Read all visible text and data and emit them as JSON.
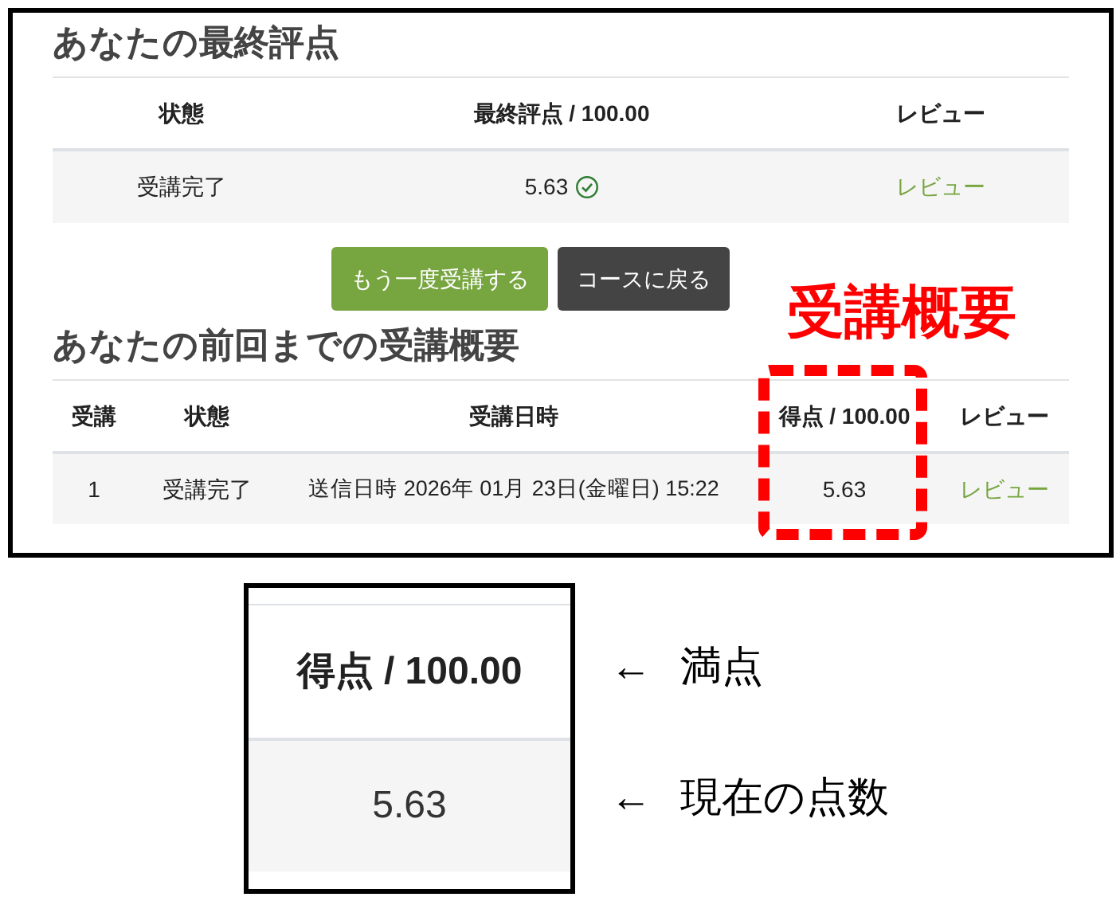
{
  "final_grade": {
    "title": "あなたの最終評点",
    "columns": [
      "状態",
      "最終評点 / 100.00",
      "レビュー"
    ],
    "row": {
      "status": "受講完了",
      "grade": "5.63",
      "passed": true,
      "review": "レビュー"
    }
  },
  "buttons": [
    {
      "label": "もう一度受講する",
      "kind": "primary"
    },
    {
      "label": "コースに戻る",
      "kind": "secondary"
    }
  ],
  "summary": {
    "title": "あなたの前回までの受講概要",
    "columns": [
      "受講",
      "状態",
      "受講日時",
      "得点 / 100.00",
      "レビュー"
    ],
    "rows": [
      {
        "attempt": "1",
        "status": "受講完了",
        "date": "送信日時 2026年 01月 23日(金曜日) 15:22",
        "grade": "5.63",
        "review": "レビュー"
      }
    ]
  },
  "annotations": {
    "callout_label": "受講概要",
    "zoom": {
      "header": "得点 / 100.00",
      "value": "5.63"
    },
    "notes": [
      {
        "arrow": "←",
        "text": "満点"
      },
      {
        "arrow": "←",
        "text": "現在の点数"
      }
    ]
  }
}
